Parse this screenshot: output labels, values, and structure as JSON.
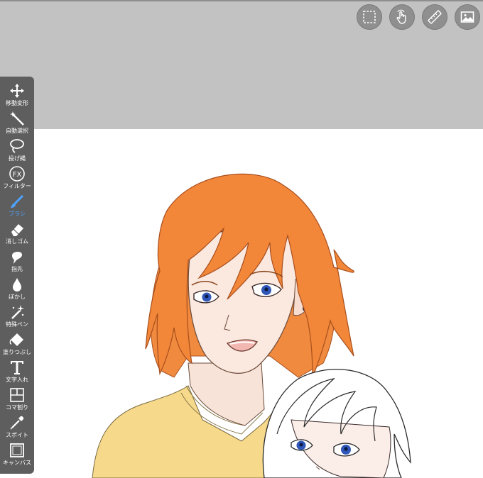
{
  "toolbar": {
    "tools": [
      {
        "label": "移動変形",
        "icon": "move-arrows-icon"
      },
      {
        "label": "自動選択",
        "icon": "magic-wand-icon"
      },
      {
        "label": "投げ縄",
        "icon": "lasso-icon"
      },
      {
        "label": "フィルター",
        "icon": "fx-filter-icon",
        "icon_text": "FX"
      },
      {
        "label": "ブラシ",
        "icon": "brush-icon",
        "active": true
      },
      {
        "label": "消しゴム",
        "icon": "eraser-icon"
      },
      {
        "label": "指先",
        "icon": "smudge-finger-icon"
      },
      {
        "label": "ぼかし",
        "icon": "blur-drop-icon"
      },
      {
        "label": "特殊ペン",
        "icon": "special-pen-icon"
      },
      {
        "label": "塗りつぶし",
        "icon": "fill-bucket-icon"
      },
      {
        "label": "文字入れ",
        "icon": "text-tool-icon",
        "icon_text": "T"
      },
      {
        "label": "コマ割り",
        "icon": "panel-divide-icon"
      },
      {
        "label": "スポイト",
        "icon": "eyedropper-icon"
      },
      {
        "label": "キャンバス",
        "icon": "canvas-icon"
      }
    ]
  },
  "topbar": {
    "buttons": [
      {
        "name": "selection-button",
        "icon": "selection-icon"
      },
      {
        "name": "gesture-button",
        "icon": "hand-gesture-icon"
      },
      {
        "name": "ruler-button",
        "icon": "ruler-icon"
      },
      {
        "name": "image-button",
        "icon": "image-icon"
      }
    ]
  },
  "colors": {
    "background": "#c2c2c2",
    "toolbar": "#5e5e5e",
    "active_tool": "#4ea3ff",
    "canvas": "#ffffff"
  }
}
